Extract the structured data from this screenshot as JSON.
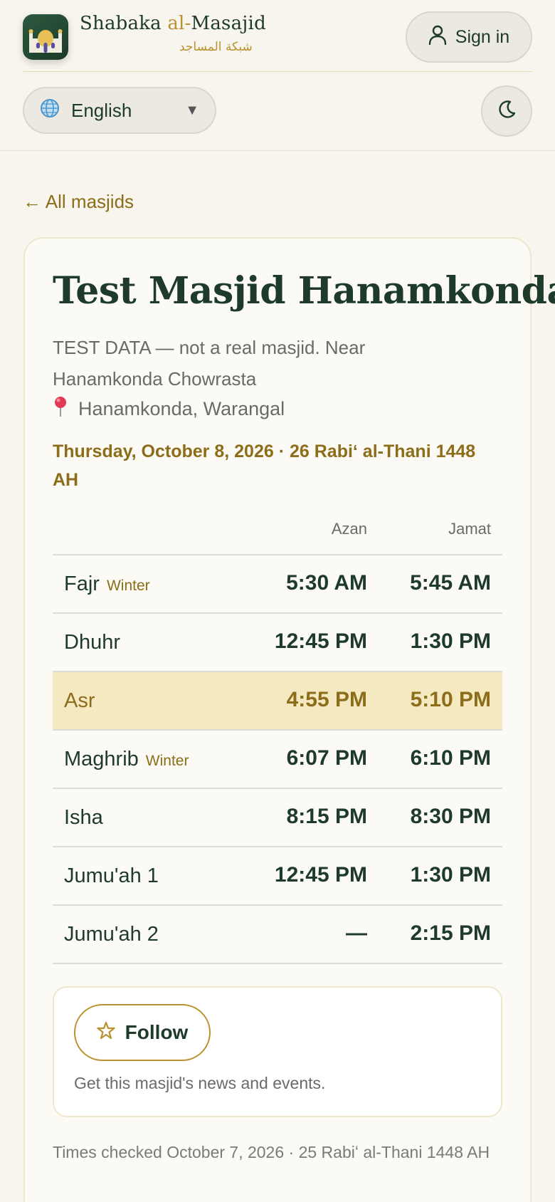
{
  "brand": {
    "name_part1": "Shabaka ",
    "name_accent": "al-",
    "name_part2": "Masajid",
    "arabic": "شبكة المساجد",
    "logo_icon": "mosque-icon"
  },
  "header": {
    "signin_label": "Sign in",
    "signin_icon": "user-icon",
    "language": "English",
    "language_icon": "globe-icon",
    "theme_icon": "moon-icon"
  },
  "nav": {
    "back_label": "← All masjids"
  },
  "masjid": {
    "name": "Test Masjid Hanamkonda",
    "description": "TEST DATA — not a real masjid. Near Hanamkonda Chowrasta",
    "location": "Hanamkonda, Warangal",
    "location_icon": "pin-icon",
    "date": "Thursday, October 8, 2026 · 26 Rabiʻ al-Thani 1448 AH"
  },
  "table": {
    "headers": {
      "azan": "Azan",
      "jamat": "Jamat"
    },
    "rows": [
      {
        "name": "Fajr",
        "season": "Winter",
        "azan": "5:30 AM",
        "jamat": "5:45 AM",
        "highlight": false
      },
      {
        "name": "Dhuhr",
        "season": "",
        "azan": "12:45 PM",
        "jamat": "1:30 PM",
        "highlight": false
      },
      {
        "name": "Asr",
        "season": "",
        "azan": "4:55 PM",
        "jamat": "5:10 PM",
        "highlight": true
      },
      {
        "name": "Maghrib",
        "season": "Winter",
        "azan": "6:07 PM",
        "jamat": "6:10 PM",
        "highlight": false
      },
      {
        "name": "Isha",
        "season": "",
        "azan": "8:15 PM",
        "jamat": "8:30 PM",
        "highlight": false
      },
      {
        "name": "Jumu'ah 1",
        "season": "",
        "azan": "12:45 PM",
        "jamat": "1:30 PM",
        "highlight": false
      },
      {
        "name": "Jumu'ah 2",
        "season": "",
        "azan": "—",
        "jamat": "2:15 PM",
        "highlight": false
      }
    ]
  },
  "follow": {
    "label": "Follow",
    "icon": "star-icon",
    "note": "Get this masjid's news and events."
  },
  "footer": {
    "checked": "Times checked October 7, 2026 · 25 Rabiʻ al-Thani 1448 AH"
  },
  "colors": {
    "primary": "#1e3a2a",
    "accent": "#b9922f",
    "highlight": "#f5e9c2",
    "background": "#f8f5ee"
  }
}
